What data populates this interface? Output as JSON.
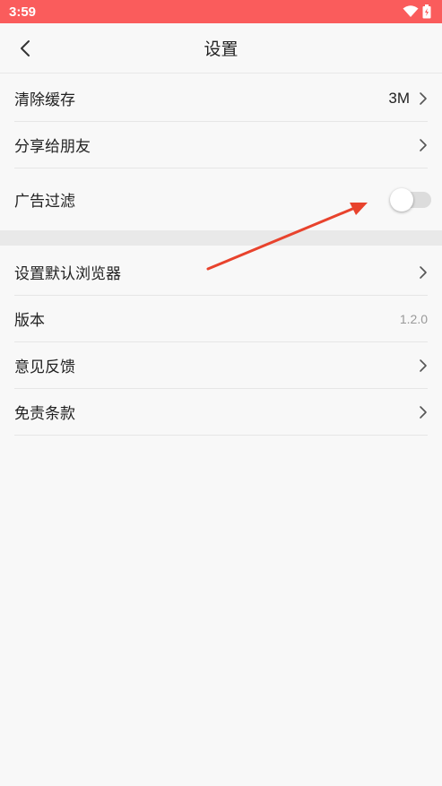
{
  "status_bar": {
    "time": "3:59",
    "icons": [
      "wifi-icon",
      "battery-icon"
    ]
  },
  "app_bar": {
    "title": "设置",
    "back_icon": "chevron-left-icon"
  },
  "group1": {
    "clear_cache": {
      "label": "清除缓存",
      "value": "3M"
    },
    "share": {
      "label": "分享给朋友"
    },
    "ad_filter": {
      "label": "广告过滤",
      "enabled": false
    }
  },
  "group2": {
    "default_browser": {
      "label": "设置默认浏览器"
    },
    "version": {
      "label": "版本",
      "value": "1.2.0"
    },
    "feedback": {
      "label": "意见反馈"
    },
    "disclaimer": {
      "label": "免责条款"
    }
  },
  "colors": {
    "status_bar": "#fa5c5c",
    "annotation_arrow": "#e8432d",
    "background": "#f8f8f8"
  }
}
